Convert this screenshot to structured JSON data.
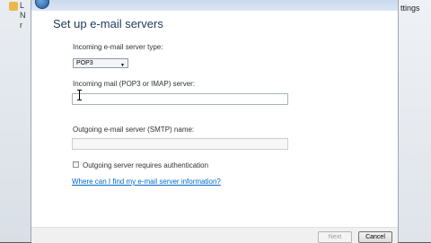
{
  "background": {
    "left_letters": [
      "L",
      "N",
      "r"
    ],
    "right_fragment": "ttings"
  },
  "dialog": {
    "title": "Set up e-mail servers",
    "incoming_type_label": "Incoming e-mail server type:",
    "incoming_type_value": "POP3",
    "incoming_server_label": "Incoming mail (POP3 or IMAP) server:",
    "incoming_server_value": "",
    "outgoing_server_label": "Outgoing e-mail server (SMTP) name:",
    "outgoing_server_value": "",
    "auth_checkbox_label": "Outgoing server requires authentication",
    "auth_checked": false,
    "help_link": "Where can I find my e-mail server information?",
    "next_label": "Next",
    "cancel_label": "Cancel"
  }
}
